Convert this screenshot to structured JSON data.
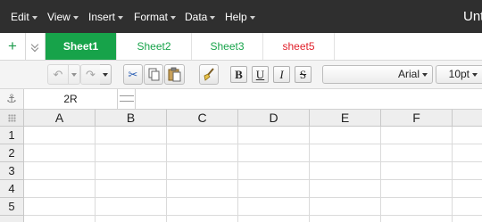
{
  "menu": {
    "items": [
      {
        "label": "Edit"
      },
      {
        "label": "View"
      },
      {
        "label": "Insert"
      },
      {
        "label": "Format"
      },
      {
        "label": "Data"
      },
      {
        "label": "Help"
      }
    ],
    "app_title": "Unt"
  },
  "tabs": {
    "add_label": "+",
    "sheets": [
      {
        "label": "Sheet1",
        "active": true,
        "color": "#ffffff"
      },
      {
        "label": "Sheet2",
        "active": false,
        "color": "#17a34a"
      },
      {
        "label": "Sheet3",
        "active": false,
        "color": "#17a34a"
      },
      {
        "label": "sheet5",
        "active": false,
        "color": "#e0202a"
      }
    ],
    "accent_color": "#17a34a"
  },
  "toolbar": {
    "undo_icon": "undo-icon",
    "redo_icon": "redo-icon",
    "cut_icon": "scissors-icon",
    "copy_icon": "copy-icon",
    "paste_icon": "paste-icon",
    "format_painter_icon": "brush-icon",
    "bold_label": "B",
    "underline_label": "U",
    "italic_label": "I",
    "strike_label": "S",
    "font_family": "Arial",
    "font_size": "10pt"
  },
  "formula_bar": {
    "anchor_icon": "anchor-icon",
    "cell_ref": "2R",
    "formula_value": ""
  },
  "grid": {
    "columns": [
      "A",
      "B",
      "C",
      "D",
      "E",
      "F"
    ],
    "rows": [
      "1",
      "2",
      "3",
      "4",
      "5"
    ]
  }
}
